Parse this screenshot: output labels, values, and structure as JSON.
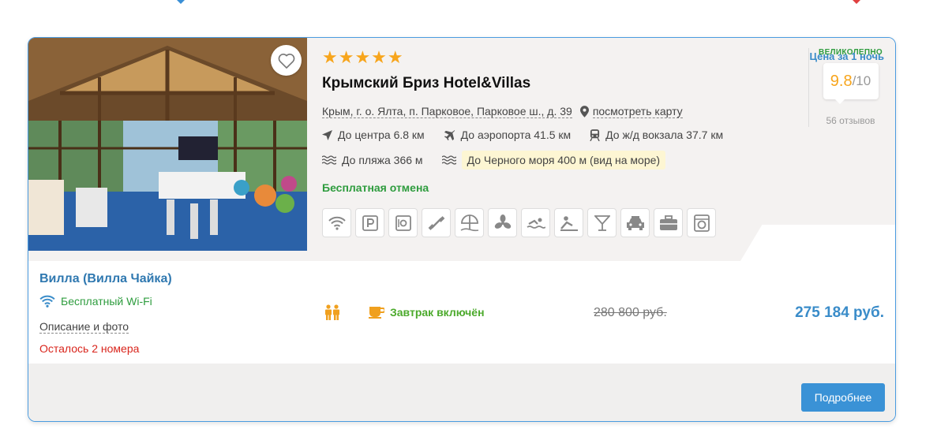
{
  "colors": {
    "accent": "#3a92d6",
    "green": "#2e9c3e",
    "star": "#f7a51c",
    "alert": "#d9251c"
  },
  "hotel": {
    "stars": "★★★★★",
    "name": "Крымский Бриз Hotel&Villas",
    "address": "Крым, г. о. Ялта, п. Парковое, Парковое ш., д. 39",
    "map_link": "посмотреть карту",
    "distances": {
      "center": "До центра 6.8 км",
      "airport": "До аэропорта 41.5 км",
      "station": "До ж/д вокзала 37.7 км",
      "beach": "До пляжа 366 м",
      "sea": "До Черного моря 400 м (вид на море)"
    },
    "free_cancel": "Бесплатная отмена",
    "amenities": [
      "wifi-icon",
      "parking-icon",
      "safe-icon",
      "gym-icon",
      "beach-umbrella-icon",
      "fan-icon",
      "pool-icon",
      "spa-icon",
      "bar-icon",
      "taxi-icon",
      "business-icon",
      "laundry-icon"
    ]
  },
  "rating": {
    "word": "ВЕЛИКОЛЕПНО",
    "score": "9.8",
    "max": "/10",
    "reviews": "56 отзывов"
  },
  "price_tab": {
    "label": "Цена за 1 ночь"
  },
  "room": {
    "title": "Вилла (Вилла Чайка)",
    "wifi": "Бесплатный Wi-Fi",
    "desc_link": "Описание и фото",
    "remaining": "Осталось 2 номера",
    "breakfast": "Завтрак включён",
    "old_price": "280 800 руб.",
    "new_price": "275 184 руб."
  },
  "actions": {
    "more": "Подробнее"
  }
}
